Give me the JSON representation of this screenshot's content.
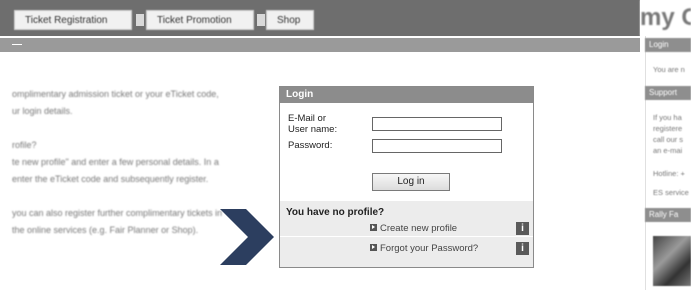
{
  "nav": {
    "tabs": [
      {
        "label": "Ticket Registration"
      },
      {
        "label": "Ticket Promotion"
      },
      {
        "label": "Shop"
      }
    ],
    "brand": "my C"
  },
  "left_text": {
    "lines": [
      "omplimentary admission ticket or your eTicket code,",
      "ur login details.",
      "",
      "rofile?",
      "te new profile\" and enter a few personal details. In a",
      "enter the eTicket code and subsequently register.",
      "",
      "you can also register further complimentary tickets in",
      "the online services (e.g. Fair Planner or Shop)."
    ]
  },
  "login": {
    "title": "Login",
    "email_label_line1": "E-Mail or",
    "email_label_line2": "User name:",
    "email_value": "",
    "password_label": "Password:",
    "password_value": "",
    "button_label": "Log in",
    "no_profile_title": "You have no profile?",
    "create_profile_link": "Create new profile",
    "forgot_password_link": "Forgot your Password?",
    "info_glyph": "i"
  },
  "sidebar": {
    "login_head": "Login",
    "login_text": "You are n",
    "support_head": "Support",
    "support_lines": [
      "If you ha",
      "registere",
      "call our s",
      "an e-mai"
    ],
    "hotline": "Hotline: +",
    "service": "ES service",
    "rally_head": "Rally Fa"
  },
  "colors": {
    "topbar": "#6e6e6e",
    "sectionbar": "#9a9a9a",
    "login_header": "#8c8c8c",
    "arrow": "#2c3e5f",
    "no_profile_bg": "#ececec"
  }
}
